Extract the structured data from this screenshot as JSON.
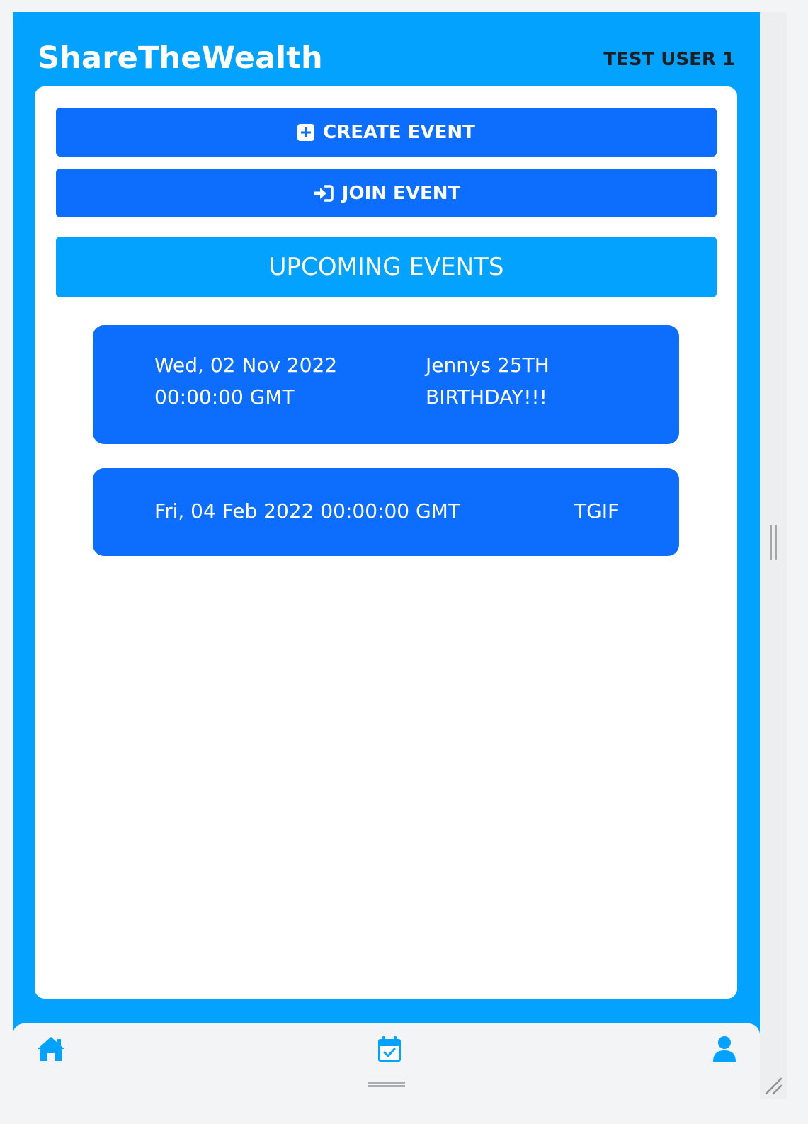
{
  "header": {
    "app_title": "ShareTheWealth",
    "user_name": "TEST USER 1"
  },
  "actions": {
    "create_label": "CREATE EVENT",
    "create_icon": "plus-square-icon",
    "join_label": "JOIN EVENT",
    "join_icon": "sign-in-icon"
  },
  "upcoming": {
    "title": "UPCOMING EVENTS",
    "events": [
      {
        "date": "Wed, 02 Nov 2022 00:00:00 GMT",
        "name": "Jennys 25TH BIRTHDAY!!!"
      },
      {
        "date": "Fri, 04 Feb 2022 00:00:00 GMT",
        "name": "TGIF"
      }
    ]
  },
  "bottom_nav": {
    "items": [
      {
        "icon": "home-icon"
      },
      {
        "icon": "calendar-check-icon"
      },
      {
        "icon": "user-icon"
      }
    ]
  },
  "colors": {
    "brand_blue": "#03a2fe",
    "button_blue": "#0d6efd",
    "card_white": "#ffffff",
    "nav_bg": "#f3f4f5"
  }
}
